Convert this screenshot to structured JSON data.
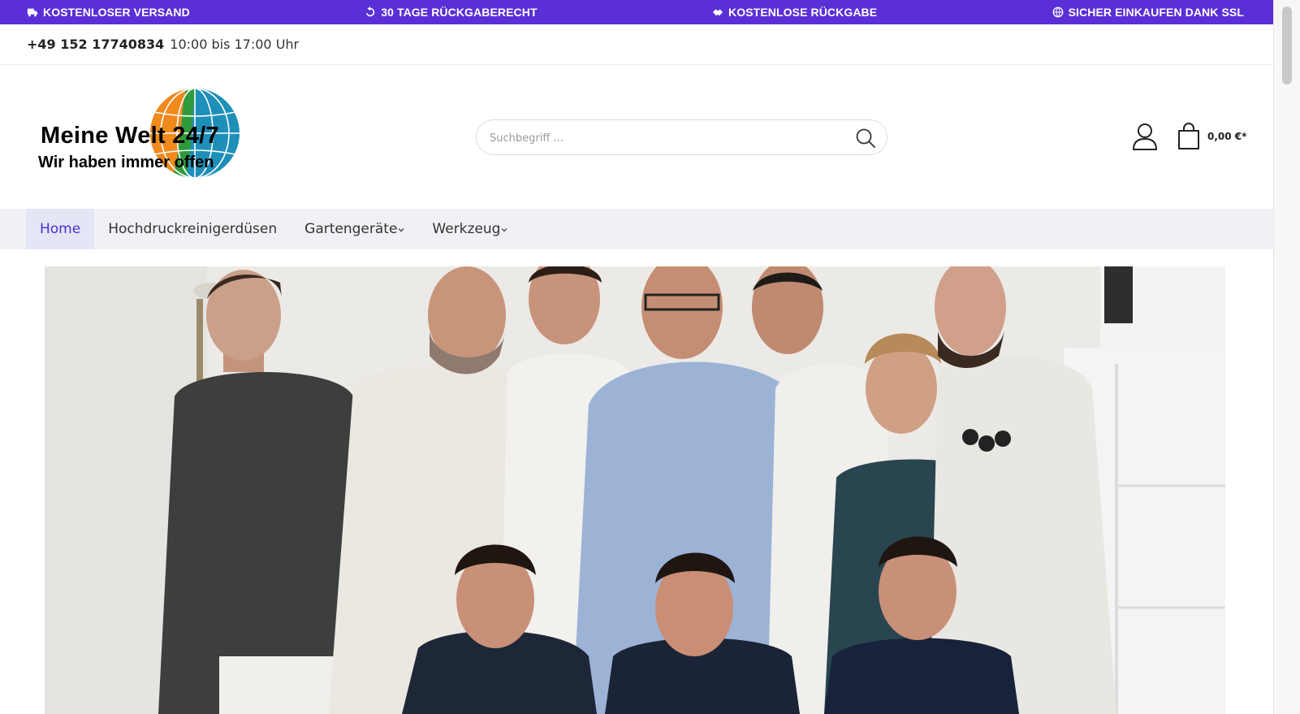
{
  "usp_bar": {
    "items": [
      {
        "icon": "truck-icon",
        "label": "KOSTENLOSER VERSAND"
      },
      {
        "icon": "undo-icon",
        "label": "30 TAGE RÜCKGABERECHT"
      },
      {
        "icon": "handshake-icon",
        "label": "KOSTENLOSE RÜCKGABE"
      },
      {
        "icon": "globe-icon",
        "label": "SICHER EINKAUFEN DANK SSL"
      }
    ],
    "background": "#5a2fd6"
  },
  "contact": {
    "phone": "+49 152 17740834",
    "hours": "10:00 bis 17:00 Uhr"
  },
  "logo": {
    "title": "Meine Welt 24/7",
    "subtitle": "Wir haben immer offen"
  },
  "search": {
    "placeholder": "Suchbegriff ..."
  },
  "cart": {
    "total": "0,00 €*"
  },
  "nav": {
    "items": [
      {
        "label": "Home",
        "active": true
      },
      {
        "label": "Hochdruckreinigerdüsen",
        "active": false
      },
      {
        "label": "Gartengeräte",
        "active": false
      },
      {
        "label": "Werkzeug",
        "active": false
      }
    ],
    "accent": "#4a2fd0"
  },
  "hero": {
    "alt": "team-photo"
  }
}
